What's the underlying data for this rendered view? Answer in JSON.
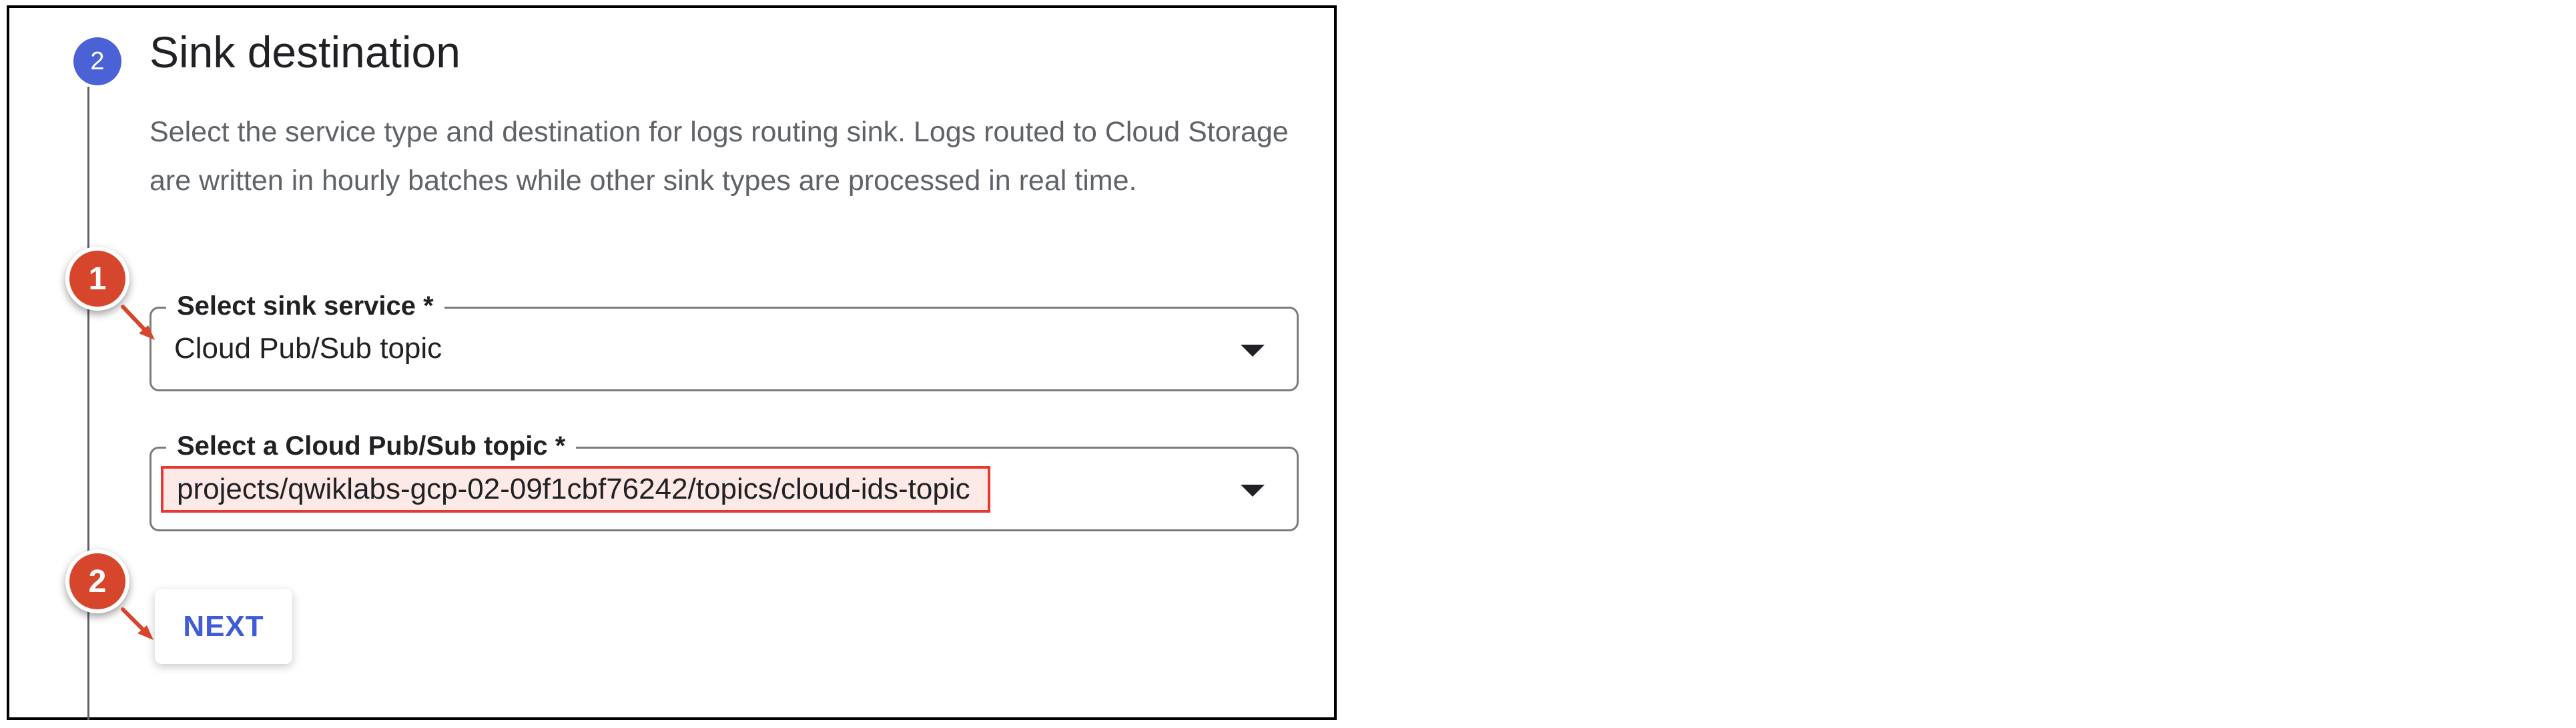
{
  "section": {
    "step_number": "2",
    "title": "Sink destination",
    "description": "Select the service type and destination for logs routing sink. Logs routed to Cloud Storage are written in hourly batches while other sink types are processed in real time."
  },
  "sink_service": {
    "label": "Select sink service *",
    "value": "Cloud Pub/Sub topic"
  },
  "pubsub_topic": {
    "label": "Select a Cloud Pub/Sub topic *",
    "value": "projects/qwiklabs-gcp-02-09f1cbf76242/topics/cloud-ids-topic"
  },
  "next_button": {
    "label": "NEXT"
  },
  "annotations": {
    "callout_1": "1",
    "callout_2": "2",
    "callout_color": "#d6462c",
    "highlight_border_color": "#e53935",
    "highlight_fill_color": "#fde9e5"
  },
  "colors": {
    "step_circle": "#4a62d6",
    "button_text": "#3f5bd6",
    "description_text": "#5f6368"
  }
}
